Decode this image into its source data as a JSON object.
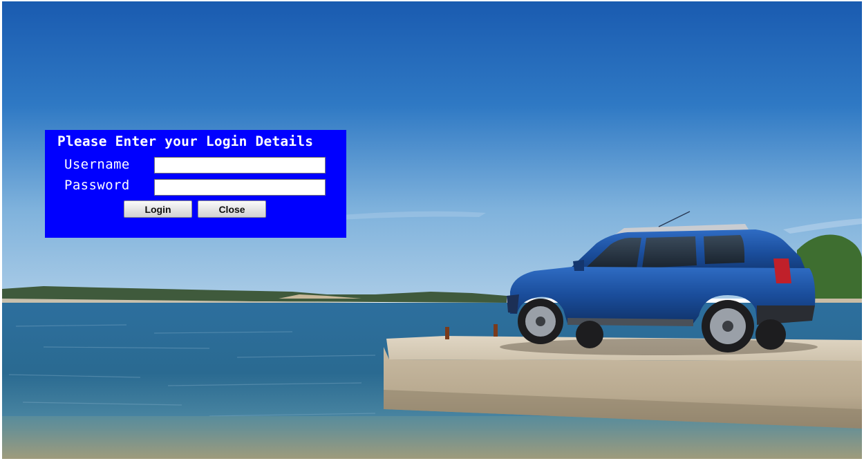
{
  "login": {
    "title": "Please Enter your Login Details",
    "username_label": "Username",
    "username_value": "",
    "password_label": "Password",
    "password_value": "",
    "login_button": "Login",
    "close_button": "Close"
  },
  "background": {
    "description_icon": "car-on-pier-photo"
  },
  "colors": {
    "panel": "#0000ff",
    "panel_text": "#ffffff"
  }
}
